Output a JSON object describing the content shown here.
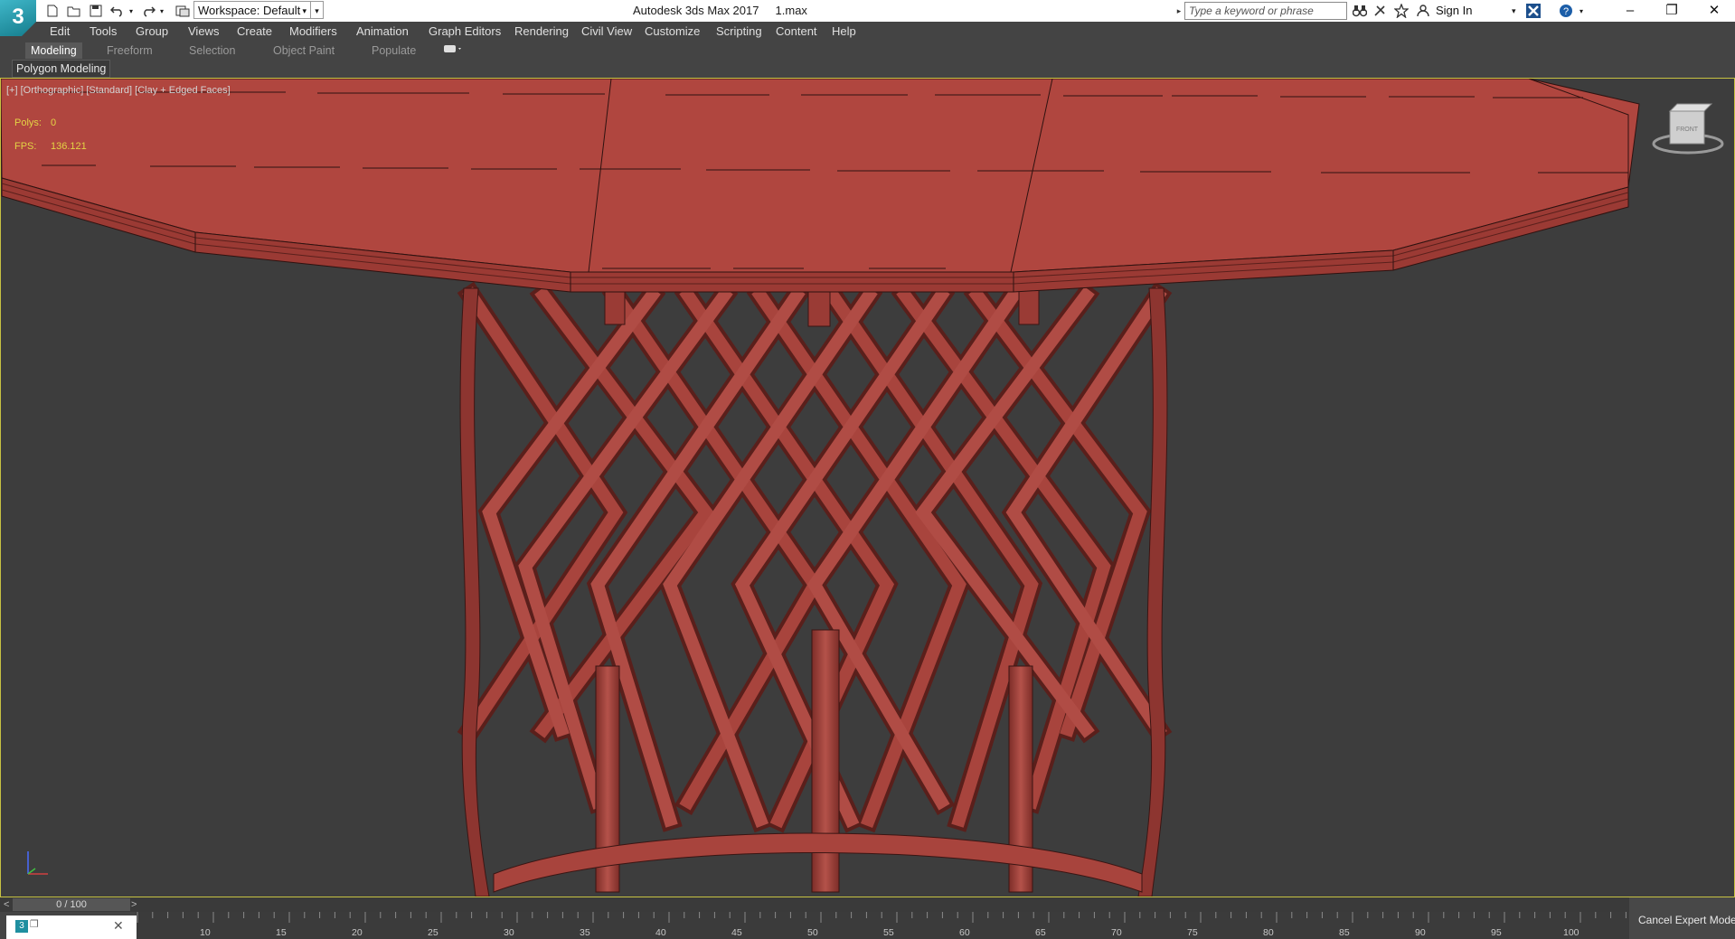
{
  "titlebar": {
    "app_logo": "3",
    "workspace_label": "Workspace: Default",
    "window_title": "Autodesk 3ds Max 2017     1.max",
    "search_placeholder": "Type a keyword or phrase",
    "signin_label": "Sign In",
    "icons": [
      "new-file-icon",
      "open-file-icon",
      "save-icon",
      "undo-icon",
      "redo-icon",
      "project-folder-icon",
      "binoculars-icon",
      "star-icon",
      "user-icon",
      "exchange-icon",
      "help-icon"
    ]
  },
  "menu": {
    "items": [
      "Edit",
      "Tools",
      "Group",
      "Views",
      "Create",
      "Modifiers",
      "Animation",
      "Graph Editors",
      "Rendering",
      "Civil View",
      "Customize",
      "Scripting",
      "Content",
      "Help"
    ]
  },
  "ribbon": {
    "tabs": [
      "Modeling",
      "Freeform",
      "Selection",
      "Object Paint",
      "Populate"
    ],
    "active_tab": "Modeling",
    "panel_label": "Polygon Modeling"
  },
  "viewport": {
    "label": "[+] [Orthographic] [Standard] [Clay + Edged Faces]",
    "polys_label": "Polys:",
    "polys_value": "0",
    "fps_label": "FPS:",
    "fps_value": "136.121",
    "viewcube_label": "FRONT",
    "model_color": "#b0463f",
    "border_color": "#c7c242"
  },
  "timeline": {
    "frame": "0 / 100",
    "prev": "<",
    "next": ">",
    "ticks": [
      "10",
      "15",
      "20",
      "25",
      "30",
      "35",
      "40",
      "45",
      "50",
      "55",
      "60",
      "65",
      "70",
      "75",
      "80",
      "85",
      "90",
      "95",
      "100"
    ]
  },
  "status": {
    "cancel_expert": "Cancel Expert Mode"
  }
}
